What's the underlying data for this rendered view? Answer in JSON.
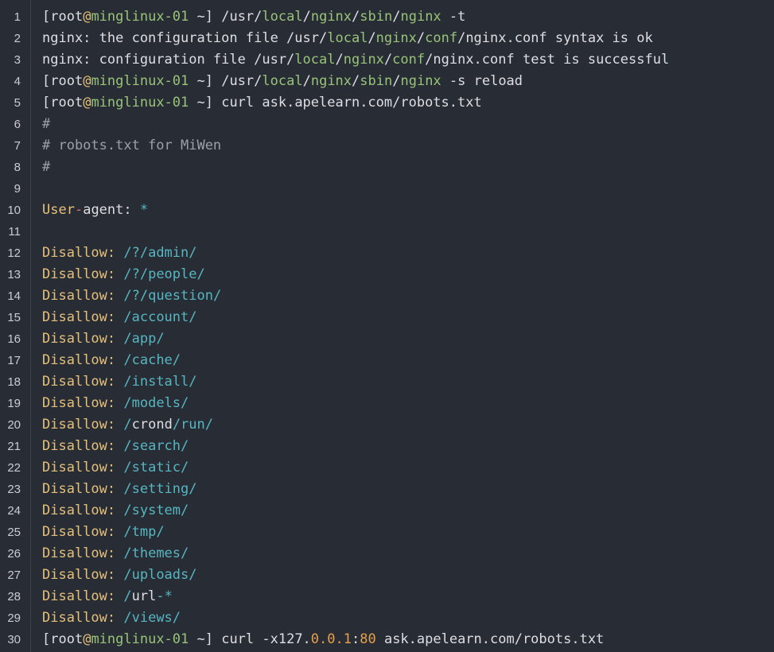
{
  "colors": {
    "background": "#282c34",
    "plain": "#dcdfe4",
    "keyword": "#e5c07b",
    "string": "#98c379",
    "comment": "#9aa0aa",
    "value": "#56b6c2",
    "number": "#e5a04b",
    "operator": "#e06c75"
  },
  "lines": [
    {
      "n": "1",
      "tokens": [
        [
          "[root",
          "plain"
        ],
        [
          "@",
          "at"
        ],
        [
          "minglinux-01",
          "host"
        ],
        [
          " ~] ",
          "plain"
        ],
        [
          "/usr/",
          "plain"
        ],
        [
          "local",
          "path"
        ],
        [
          "/",
          "plain"
        ],
        [
          "nginx",
          "path"
        ],
        [
          "/",
          "plain"
        ],
        [
          "sbin",
          "path"
        ],
        [
          "/",
          "plain"
        ],
        [
          "nginx",
          "path"
        ],
        [
          " -t",
          "plain"
        ]
      ]
    },
    {
      "n": "2",
      "tokens": [
        [
          "nginx: the configuration file ",
          "plain"
        ],
        [
          "/usr/",
          "plain"
        ],
        [
          "local",
          "path"
        ],
        [
          "/",
          "plain"
        ],
        [
          "nginx",
          "path"
        ],
        [
          "/",
          "plain"
        ],
        [
          "conf",
          "path"
        ],
        [
          "/",
          "plain"
        ],
        [
          "nginx.conf syntax is ok",
          "plain"
        ]
      ]
    },
    {
      "n": "3",
      "tokens": [
        [
          "nginx: configuration file ",
          "plain"
        ],
        [
          "/usr/",
          "plain"
        ],
        [
          "local",
          "path"
        ],
        [
          "/",
          "plain"
        ],
        [
          "nginx",
          "path"
        ],
        [
          "/",
          "plain"
        ],
        [
          "conf",
          "path"
        ],
        [
          "/",
          "plain"
        ],
        [
          "nginx.conf test is successful",
          "plain"
        ]
      ]
    },
    {
      "n": "4",
      "tokens": [
        [
          "[root",
          "plain"
        ],
        [
          "@",
          "at"
        ],
        [
          "minglinux-01",
          "host"
        ],
        [
          " ~] ",
          "plain"
        ],
        [
          "/usr/",
          "plain"
        ],
        [
          "local",
          "path"
        ],
        [
          "/",
          "plain"
        ],
        [
          "nginx",
          "path"
        ],
        [
          "/",
          "plain"
        ],
        [
          "sbin",
          "path"
        ],
        [
          "/",
          "plain"
        ],
        [
          "nginx",
          "path"
        ],
        [
          " -s reload",
          "plain"
        ]
      ]
    },
    {
      "n": "5",
      "tokens": [
        [
          "[root",
          "plain"
        ],
        [
          "@",
          "at"
        ],
        [
          "minglinux-01",
          "host"
        ],
        [
          " ~] curl ask.apelearn.com/robots.txt",
          "plain"
        ]
      ]
    },
    {
      "n": "6",
      "tokens": [
        [
          "#",
          "comment"
        ]
      ]
    },
    {
      "n": "7",
      "tokens": [
        [
          "# robots.txt for MiWen",
          "comment"
        ]
      ]
    },
    {
      "n": "8",
      "tokens": [
        [
          "#",
          "comment"
        ]
      ]
    },
    {
      "n": "9",
      "tokens": []
    },
    {
      "n": "10",
      "tokens": [
        [
          "User",
          "key"
        ],
        [
          "-",
          "op"
        ],
        [
          "agent: ",
          "plain"
        ],
        [
          "*",
          "val"
        ]
      ]
    },
    {
      "n": "11",
      "tokens": []
    },
    {
      "n": "12",
      "tokens": [
        [
          "Disallow:",
          "key"
        ],
        [
          " ",
          "plain"
        ],
        [
          "/?/admin/",
          "val"
        ]
      ]
    },
    {
      "n": "13",
      "tokens": [
        [
          "Disallow:",
          "key"
        ],
        [
          " ",
          "plain"
        ],
        [
          "/?/people/",
          "val"
        ]
      ]
    },
    {
      "n": "14",
      "tokens": [
        [
          "Disallow:",
          "key"
        ],
        [
          " ",
          "plain"
        ],
        [
          "/?/question/",
          "val"
        ]
      ]
    },
    {
      "n": "15",
      "tokens": [
        [
          "Disallow:",
          "key"
        ],
        [
          " ",
          "plain"
        ],
        [
          "/account/",
          "val"
        ]
      ]
    },
    {
      "n": "16",
      "tokens": [
        [
          "Disallow:",
          "key"
        ],
        [
          " ",
          "plain"
        ],
        [
          "/app/",
          "val"
        ]
      ]
    },
    {
      "n": "17",
      "tokens": [
        [
          "Disallow:",
          "key"
        ],
        [
          " ",
          "plain"
        ],
        [
          "/cache/",
          "val"
        ]
      ]
    },
    {
      "n": "18",
      "tokens": [
        [
          "Disallow:",
          "key"
        ],
        [
          " ",
          "plain"
        ],
        [
          "/install/",
          "val"
        ]
      ]
    },
    {
      "n": "19",
      "tokens": [
        [
          "Disallow:",
          "key"
        ],
        [
          " ",
          "plain"
        ],
        [
          "/models/",
          "val"
        ]
      ]
    },
    {
      "n": "20",
      "tokens": [
        [
          "Disallow:",
          "key"
        ],
        [
          " ",
          "plain"
        ],
        [
          "/",
          "val"
        ],
        [
          "crond",
          "plain"
        ],
        [
          "/run/",
          "val"
        ]
      ]
    },
    {
      "n": "21",
      "tokens": [
        [
          "Disallow:",
          "key"
        ],
        [
          " ",
          "plain"
        ],
        [
          "/search/",
          "val"
        ]
      ]
    },
    {
      "n": "22",
      "tokens": [
        [
          "Disallow:",
          "key"
        ],
        [
          " ",
          "plain"
        ],
        [
          "/static/",
          "val"
        ]
      ]
    },
    {
      "n": "23",
      "tokens": [
        [
          "Disallow:",
          "key"
        ],
        [
          " ",
          "plain"
        ],
        [
          "/setting/",
          "val"
        ]
      ]
    },
    {
      "n": "24",
      "tokens": [
        [
          "Disallow:",
          "key"
        ],
        [
          " ",
          "plain"
        ],
        [
          "/system/",
          "val"
        ]
      ]
    },
    {
      "n": "25",
      "tokens": [
        [
          "Disallow:",
          "key"
        ],
        [
          " ",
          "plain"
        ],
        [
          "/tmp/",
          "val"
        ]
      ]
    },
    {
      "n": "26",
      "tokens": [
        [
          "Disallow:",
          "key"
        ],
        [
          " ",
          "plain"
        ],
        [
          "/themes/",
          "val"
        ]
      ]
    },
    {
      "n": "27",
      "tokens": [
        [
          "Disallow:",
          "key"
        ],
        [
          " ",
          "plain"
        ],
        [
          "/uploads/",
          "val"
        ]
      ]
    },
    {
      "n": "28",
      "tokens": [
        [
          "Disallow:",
          "key"
        ],
        [
          " ",
          "plain"
        ],
        [
          "/",
          "val"
        ],
        [
          "url",
          "plain"
        ],
        [
          "-*",
          "val"
        ]
      ]
    },
    {
      "n": "29",
      "tokens": [
        [
          "Disallow:",
          "key"
        ],
        [
          " ",
          "plain"
        ],
        [
          "/views/",
          "val"
        ]
      ]
    },
    {
      "n": "30",
      "tokens": [
        [
          "[root",
          "plain"
        ],
        [
          "@",
          "at"
        ],
        [
          "minglinux-01",
          "host"
        ],
        [
          " ~] curl -x127.",
          "plain"
        ],
        [
          "0.0.1",
          "num"
        ],
        [
          ":",
          "plain"
        ],
        [
          "80",
          "num"
        ],
        [
          " ask.apelearn.com/robots.txt",
          "plain"
        ]
      ]
    }
  ]
}
